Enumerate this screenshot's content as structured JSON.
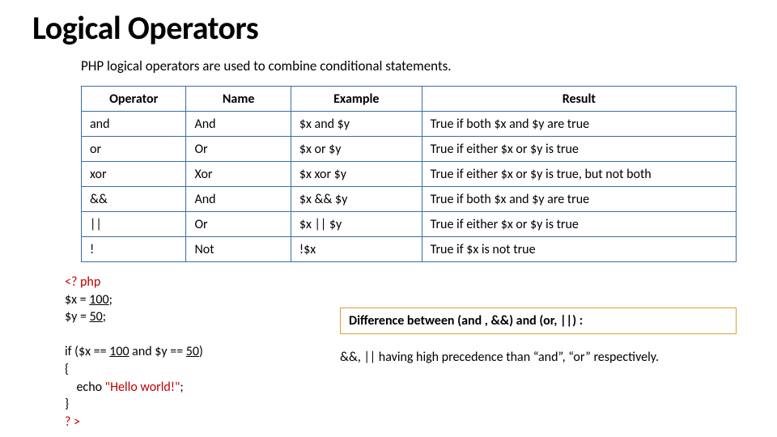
{
  "title": "Logical Operators",
  "intro": "PHP logical operators are used to combine conditional statements.",
  "headers": {
    "operator": "Operator",
    "name": "Name",
    "example": "Example",
    "result": "Result"
  },
  "rows": [
    {
      "operator": "and",
      "name": "And",
      "example": "$x and $y",
      "result": "True if both $x and $y are true"
    },
    {
      "operator": "or",
      "name": "Or",
      "example": "$x or $y",
      "result": "True if either $x or $y is true"
    },
    {
      "operator": "xor",
      "name": "Xor",
      "example": "$x xor $y",
      "result": "True if either $x or $y is true, but not both"
    },
    {
      "operator": "&&",
      "name": "And",
      "example": "$x && $y",
      "result": "True if both $x and $y are true"
    },
    {
      "operator": "||",
      "name": "Or",
      "example": "$x || $y",
      "result": "True if either $x or $y is true"
    },
    {
      "operator": "!",
      "name": "Not",
      "example": "!$x",
      "result": "True if $x is not true"
    }
  ],
  "code": {
    "l1": "<? php",
    "l2a": "$x = ",
    "l2b": "100",
    "l2c": ";",
    "l3a": "$y = ",
    "l3b": "50",
    "l3c": ";",
    "l4a": "if ($x == ",
    "l4b": "100",
    "l4c": " and $y == ",
    "l4d": "50",
    "l4e": ")",
    "l5": "{",
    "l6a": "    echo ",
    "l6b": "\"Hello world!\"",
    "l6c": "; ",
    "l7": "}",
    "l8": "? >"
  },
  "diff_title": "Difference between (and , &&) and (or, ||)  :",
  "precedence_note": "&&, || having high precedence than “and”, “or” respectively.",
  "chart_data": {
    "type": "table",
    "columns": [
      "Operator",
      "Name",
      "Example",
      "Result"
    ],
    "rows": [
      [
        "and",
        "And",
        "$x and $y",
        "True if both $x and $y are true"
      ],
      [
        "or",
        "Or",
        "$x or $y",
        "True if either $x or $y is true"
      ],
      [
        "xor",
        "Xor",
        "$x xor $y",
        "True if either $x or $y is true, but not both"
      ],
      [
        "&&",
        "And",
        "$x && $y",
        "True if both $x and $y are true"
      ],
      [
        "||",
        "Or",
        "$x || $y",
        "True if either $x or $y is true"
      ],
      [
        "!",
        "Not",
        "!$x",
        "True if $x is not true"
      ]
    ]
  }
}
